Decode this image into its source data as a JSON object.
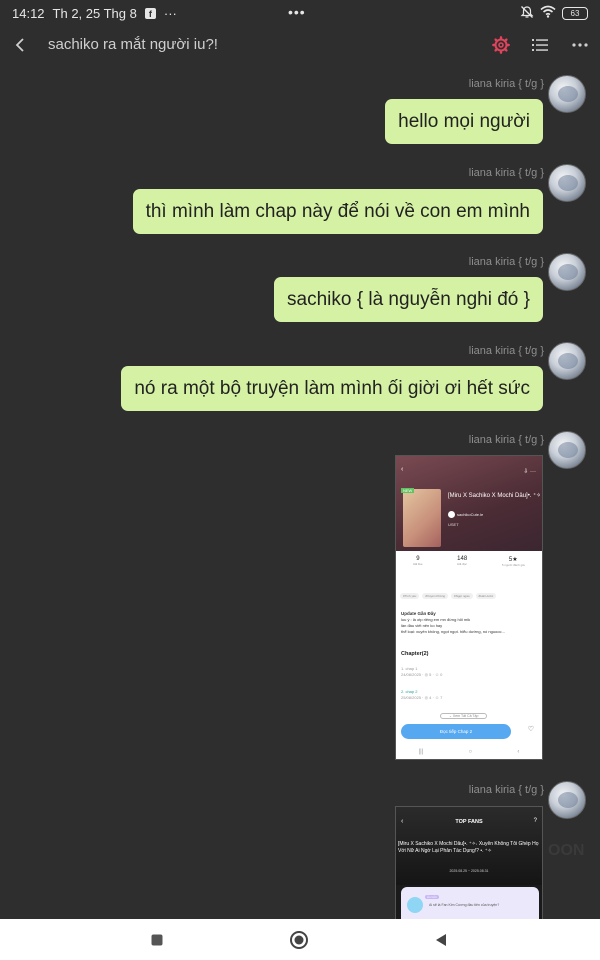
{
  "status_bar": {
    "time": "14:12",
    "date": "Th 2, 25 Thg 8",
    "fb_badge": "f",
    "more_dots": "···",
    "center_dots": "•••",
    "battery": "63",
    "icons": [
      "facebook-icon",
      "mute-icon",
      "wifi-icon",
      "battery-icon"
    ]
  },
  "header": {
    "title": "sachiko ra mắt người iu?!",
    "accent_color": "#e0445c",
    "icons": [
      "back-icon",
      "settings-gear-icon",
      "list-icon",
      "more-icon"
    ]
  },
  "messages": [
    {
      "author": "liana kiria { t/g }",
      "text": "hello mọi người"
    },
    {
      "author": "liana kiria { t/g }",
      "text": "thì mình làm chap này để nói về con em mình"
    },
    {
      "author": "liana kiria { t/g }",
      "text": "sachiko { là nguyễn nghi đó }"
    },
    {
      "author": "liana kiria { t/g }",
      "text": "nó ra một bộ truyện làm mình ối giời ơi hết sức"
    },
    {
      "author": "liana kiria { t/g }",
      "image": "story-detail-screenshot"
    },
    {
      "author": "liana kiria { t/g }",
      "image": "top-fans-screenshot"
    }
  ],
  "bubble_color": "#d5f2a4",
  "screenshot1": {
    "badge": "NEW",
    "title": "[Miru X Sachiko X Mochi Dâu]•. ⁺✧˖ Xuyên Không Tôi G...",
    "author": "sachikoCute.le",
    "small": "USET",
    "stats": [
      {
        "value": "9",
        "label": "Đã like"
      },
      {
        "value": "148",
        "label": "Đã đọc"
      },
      {
        "value": "5★",
        "label": "5 người đánh giá"
      }
    ],
    "tags": [
      "#Tình yêu",
      "#Xuyên Không",
      "#Ngọt ngào",
      "#Hài Hước"
    ],
    "update_title": "Update Gần Đây",
    "update_lines": [
      "luu ý : là otp riêng em mn đừng hỏi mik",
      "lần đầu viết nên ko hay",
      "thể loại: xuyên không, ngọt ngọt. hiểu dường, nó nguooc..."
    ],
    "chapter_header": "Chapter(2)",
    "chapters": [
      {
        "name": "1. chap 1",
        "meta": "24/08/2025 · ◎ 5 · ☺ 0"
      },
      {
        "name": "2. chap 2",
        "meta": "25/08/2025 · ◎ 4 · ☺ 7"
      }
    ],
    "see_all": "⌄ Xem Tất Cả Tập",
    "read_button": "Đọc tiếp Chap 2",
    "like_label": "Like"
  },
  "screenshot2": {
    "title": "TOP FANS",
    "name": "[Miru X Sachiko X Mochi Dâu]•. ⁺✧˖ Xuyên Không Tôi Ghép Họ Với Nữ Ai Ngờ Lại Phản Tác Dụng!? •. ⁺✧",
    "date": "2025.08.25 ~ 2025.08.31",
    "card_tag": "Ấu Gửi",
    "card_question": "Ai sẽ là Fan Kim Cương đầu tiên của truyện?"
  },
  "watermark": "OON",
  "nav_bar": {
    "icons": [
      "recents-square-icon",
      "home-circle-icon",
      "back-triangle-icon"
    ]
  }
}
